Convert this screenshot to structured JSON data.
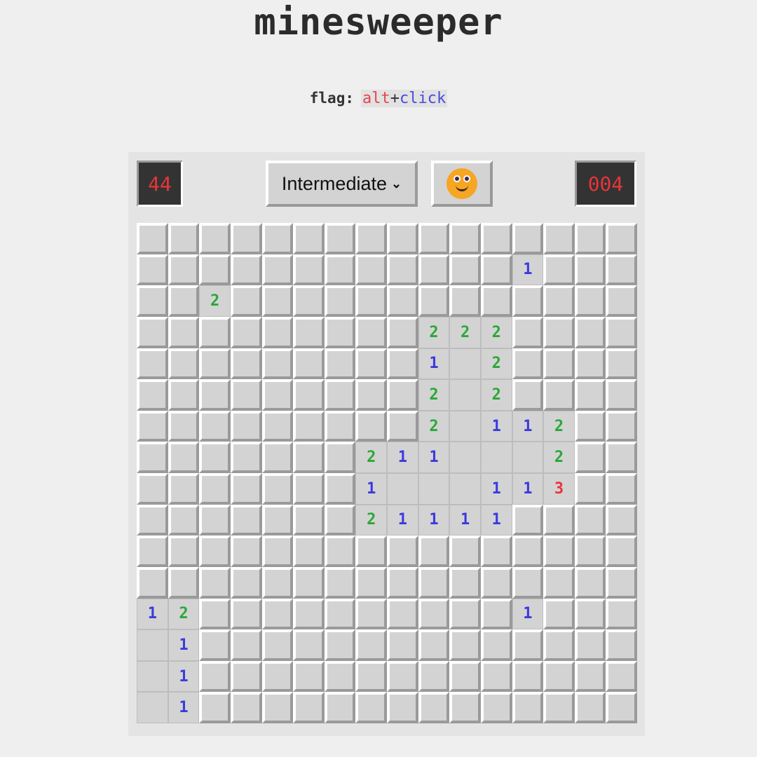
{
  "title": "minesweeper",
  "hint": {
    "label": "flag:",
    "key1": "alt",
    "plus": "+",
    "key2": "click"
  },
  "header": {
    "mines_remaining": "44",
    "difficulty": "Intermediate",
    "face_icon": "smiley-face-icon",
    "timer": "004"
  },
  "colors": {
    "1": "#3b3bdd",
    "2": "#2aa838",
    "3": "#e8343a"
  },
  "board_legend": {
    "#": "hidden",
    "0": "revealed-empty",
    "1-8": "revealed-number"
  },
  "board": [
    "################",
    "############1###",
    "##2#############",
    "#########222####",
    "#########102####",
    "#########202####",
    "#########20112##",
    "#######2110002##",
    "#######1000113##",
    "#######21111####",
    "################",
    "################",
    "12##########1###",
    "01##############",
    "01##############",
    "01##############"
  ]
}
